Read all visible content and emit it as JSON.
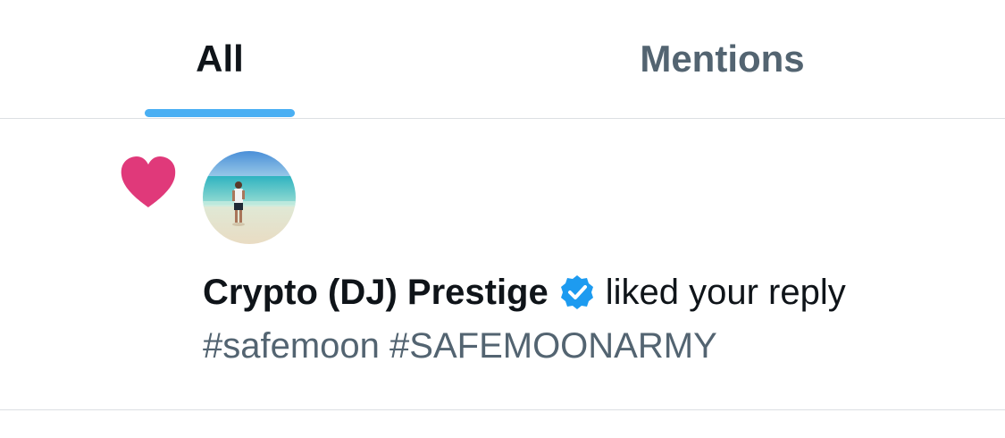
{
  "tabs": [
    {
      "label": "All",
      "selected": true
    },
    {
      "label": "Mentions",
      "selected": false
    }
  ],
  "notification": {
    "type_icon": "heart-icon",
    "user_name": "Crypto (DJ) Prestige",
    "verified_icon": "verified-badge-icon",
    "action_text": "liked your reply",
    "preview_text": "#safemoon #SAFEMOONARMY"
  },
  "colors": {
    "accent_blue": "#1d9bf0",
    "heart_pink": "#e0245e",
    "text_primary": "#0f1419",
    "text_secondary": "#536471",
    "divider": "#dcdfe3"
  }
}
